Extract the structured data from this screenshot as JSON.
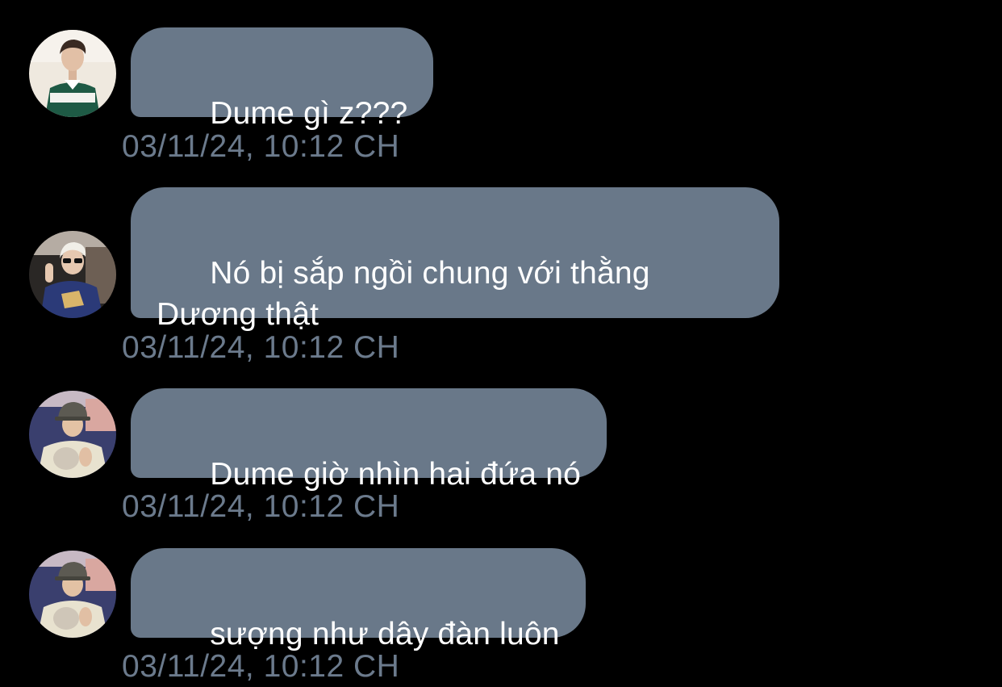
{
  "colors": {
    "background": "#000000",
    "bubble": "#697889",
    "bubble_text": "#ffffff",
    "timestamp": "#6b7a8c"
  },
  "messages": [
    {
      "avatar": "avatar-photo-green-jersey",
      "text": "Dume gì z???",
      "timestamp": "03/11/24, 10:12 CH"
    },
    {
      "avatar": "avatar-photo-sunglasses-car",
      "text": "Nó bị sắp ngồi chung với thằng\nDương thật",
      "timestamp": "03/11/24, 10:12 CH"
    },
    {
      "avatar": "avatar-photo-cap-cat",
      "text": "Dume giờ nhìn hai đứa nó",
      "timestamp": "03/11/24, 10:12 CH"
    },
    {
      "avatar": "avatar-photo-cap-cat",
      "text": "sượng như dây đàn luôn",
      "timestamp": "03/11/24, 10:12 CH"
    }
  ]
}
